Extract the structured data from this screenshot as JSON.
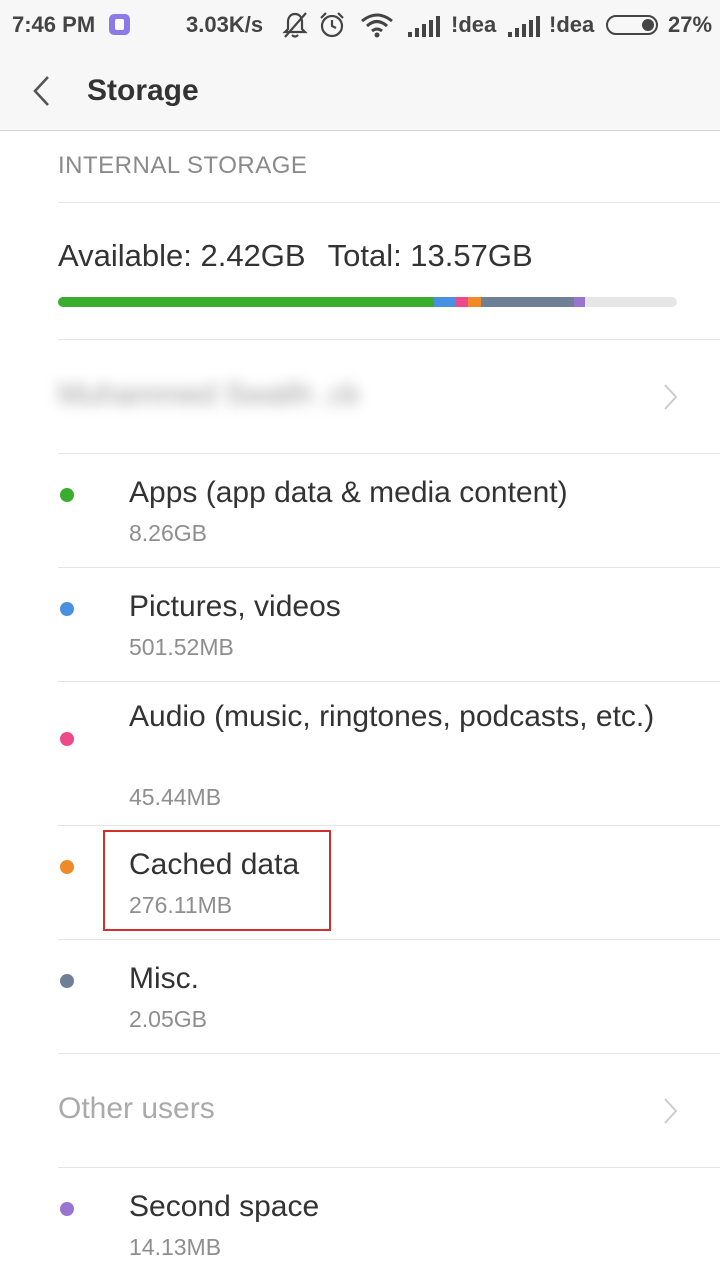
{
  "status_bar": {
    "time": "7:46 PM",
    "speed": "3.03K/s",
    "carrier_1": "!dea",
    "carrier_2": "!dea",
    "battery": "27%"
  },
  "header": {
    "title": "Storage"
  },
  "internal_storage": {
    "section_label": "INTERNAL STORAGE",
    "available": "Available: 2.42GB",
    "total": "Total: 13.57GB"
  },
  "usage_bar": {
    "segments": [
      {
        "name": "Apps",
        "fraction": 0.607,
        "color": "#3aad2f"
      },
      {
        "name": "Pictures, videos",
        "fraction": 0.036,
        "color": "#4a90e2"
      },
      {
        "name": "Audio",
        "fraction": 0.019,
        "color": "#ec4a8a"
      },
      {
        "name": "Cached data",
        "fraction": 0.021,
        "color": "#f0892a"
      },
      {
        "name": "Misc.",
        "fraction": 0.151,
        "color": "#6f7f96"
      },
      {
        "name": "Second space",
        "fraction": 0.018,
        "color": "#9a74d1"
      }
    ]
  },
  "user": {
    "name": "Muhammed Swalih .ck"
  },
  "categories": [
    {
      "label": "Apps (app data & media content)",
      "size": "8.26GB",
      "color": "#3aad2f"
    },
    {
      "label": "Pictures, videos",
      "size": "501.52MB",
      "color": "#4a90e2"
    },
    {
      "label": "Audio (music, ringtones, podcasts, etc.)",
      "size": "45.44MB",
      "color": "#ec4a8a"
    },
    {
      "label": "Cached data",
      "size": "276.11MB",
      "color": "#f0892a"
    },
    {
      "label": "Misc.",
      "size": "2.05GB",
      "color": "#6f7f96"
    }
  ],
  "other_users": {
    "label": "Other users"
  },
  "second_space": {
    "label": "Second space",
    "size": "14.13MB",
    "color": "#9a74d1"
  }
}
